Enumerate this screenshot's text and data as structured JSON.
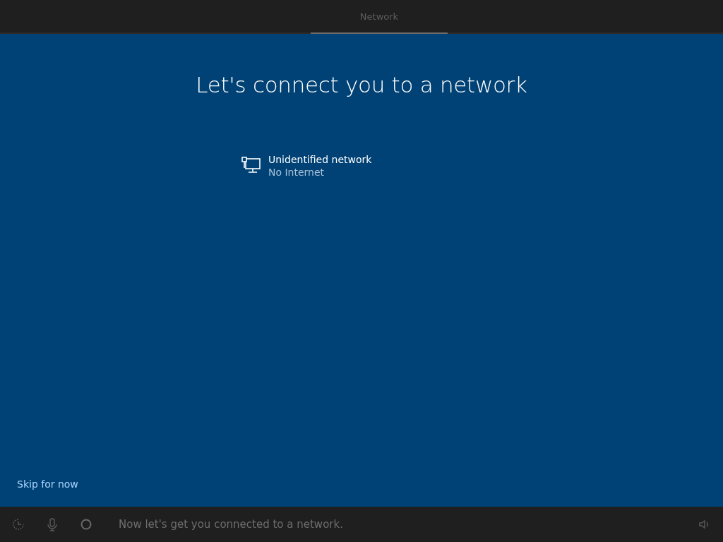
{
  "header": {
    "steps": [
      {
        "label": "Network",
        "selected": true
      }
    ]
  },
  "title": "Let's connect you to a network",
  "networks": [
    {
      "name": "Unidentified network",
      "status": "No Internet"
    }
  ],
  "skip_link": "Skip for now",
  "bottom_bar": {
    "caption": "Now let's get you connected to a network."
  }
}
